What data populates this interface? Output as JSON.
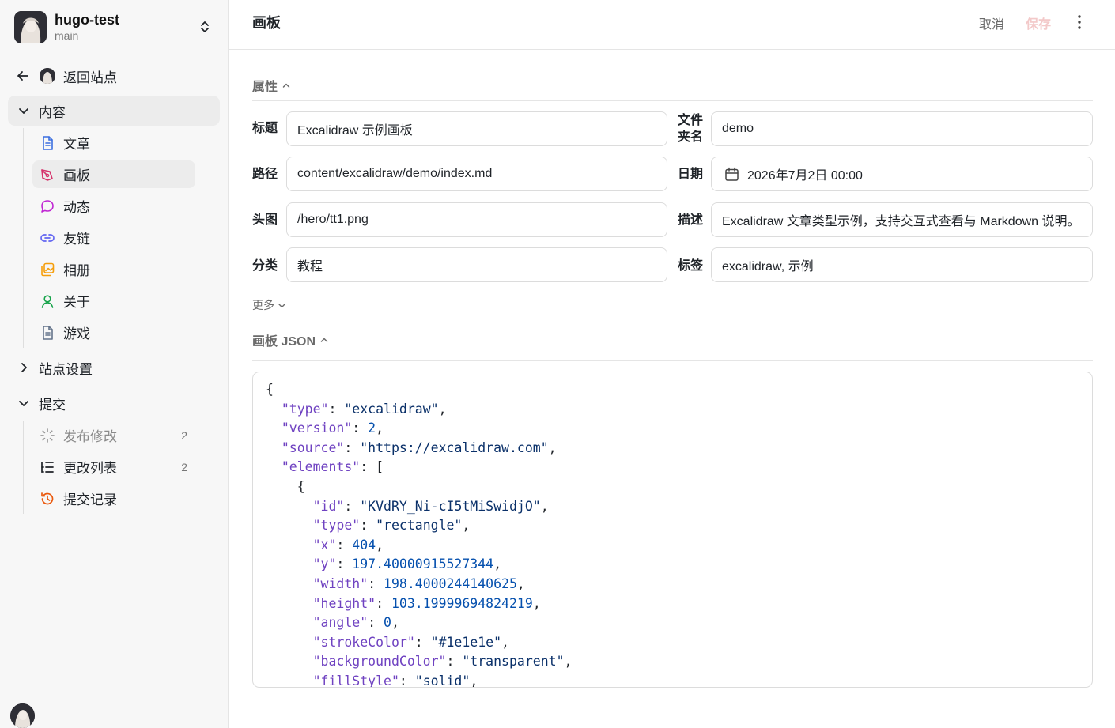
{
  "sidebar": {
    "site_name": "hugo-test",
    "branch": "main",
    "back_label": "返回站点",
    "groups": {
      "content": "内容",
      "site_settings": "站点设置",
      "commit": "提交"
    },
    "content_items": [
      {
        "label": "文章",
        "icon": "document-icon"
      },
      {
        "label": "画板",
        "icon": "pen-tool-icon"
      },
      {
        "label": "动态",
        "icon": "chat-bubble-icon"
      },
      {
        "label": "友链",
        "icon": "link-icon"
      },
      {
        "label": "相册",
        "icon": "image-gallery-icon"
      },
      {
        "label": "关于",
        "icon": "user-icon"
      },
      {
        "label": "游戏",
        "icon": "document-icon"
      }
    ],
    "commit_items": [
      {
        "label": "发布修改",
        "count": "2",
        "icon": "loader-icon"
      },
      {
        "label": "更改列表",
        "count": "2",
        "icon": "list-tree-icon"
      },
      {
        "label": "提交记录",
        "count": "",
        "icon": "history-icon"
      }
    ]
  },
  "header": {
    "title": "画板",
    "cancel_label": "取消",
    "save_label": "保存"
  },
  "properties": {
    "section_title": "属性",
    "title_label": "标题",
    "title_value": "Excalidraw 示例画板",
    "folder_label_line1": "文件",
    "folder_label_line2": "夹名",
    "folder_value": "demo",
    "path_label": "路径",
    "path_value": "content/excalidraw/demo/index.md",
    "date_label": "日期",
    "date_value": "2026年7月2日 00:00",
    "hero_label": "头图",
    "hero_value": "/hero/tt1.png",
    "desc_label": "描述",
    "desc_value": "Excalidraw 文章类型示例，支持交互式查看与 Markdown 说明。",
    "category_label": "分类",
    "category_value": "教程",
    "tags_label": "标签",
    "tags_value": "excalidraw, 示例",
    "more_label": "更多"
  },
  "json_section": {
    "title": "画板 JSON",
    "lines": [
      {
        "indent": 0,
        "parts": [
          {
            "t": "pun",
            "v": "{"
          }
        ]
      },
      {
        "indent": 1,
        "parts": [
          {
            "t": "key",
            "v": "\"type\""
          },
          {
            "t": "pun",
            "v": ": "
          },
          {
            "t": "str",
            "v": "\"excalidraw\""
          },
          {
            "t": "pun",
            "v": ","
          }
        ]
      },
      {
        "indent": 1,
        "parts": [
          {
            "t": "key",
            "v": "\"version\""
          },
          {
            "t": "pun",
            "v": ": "
          },
          {
            "t": "num",
            "v": "2"
          },
          {
            "t": "pun",
            "v": ","
          }
        ]
      },
      {
        "indent": 1,
        "parts": [
          {
            "t": "key",
            "v": "\"source\""
          },
          {
            "t": "pun",
            "v": ": "
          },
          {
            "t": "str",
            "v": "\"https://excalidraw.com\""
          },
          {
            "t": "pun",
            "v": ","
          }
        ]
      },
      {
        "indent": 1,
        "parts": [
          {
            "t": "key",
            "v": "\"elements\""
          },
          {
            "t": "pun",
            "v": ": ["
          }
        ]
      },
      {
        "indent": 2,
        "parts": [
          {
            "t": "pun",
            "v": "{"
          }
        ]
      },
      {
        "indent": 3,
        "parts": [
          {
            "t": "key",
            "v": "\"id\""
          },
          {
            "t": "pun",
            "v": ": "
          },
          {
            "t": "str",
            "v": "\"KVdRY_Ni-cI5tMiSwidjO\""
          },
          {
            "t": "pun",
            "v": ","
          }
        ]
      },
      {
        "indent": 3,
        "parts": [
          {
            "t": "key",
            "v": "\"type\""
          },
          {
            "t": "pun",
            "v": ": "
          },
          {
            "t": "str",
            "v": "\"rectangle\""
          },
          {
            "t": "pun",
            "v": ","
          }
        ]
      },
      {
        "indent": 3,
        "parts": [
          {
            "t": "key",
            "v": "\"x\""
          },
          {
            "t": "pun",
            "v": ": "
          },
          {
            "t": "num",
            "v": "404"
          },
          {
            "t": "pun",
            "v": ","
          }
        ]
      },
      {
        "indent": 3,
        "parts": [
          {
            "t": "key",
            "v": "\"y\""
          },
          {
            "t": "pun",
            "v": ": "
          },
          {
            "t": "num",
            "v": "197.40000915527344"
          },
          {
            "t": "pun",
            "v": ","
          }
        ]
      },
      {
        "indent": 3,
        "parts": [
          {
            "t": "key",
            "v": "\"width\""
          },
          {
            "t": "pun",
            "v": ": "
          },
          {
            "t": "num",
            "v": "198.4000244140625"
          },
          {
            "t": "pun",
            "v": ","
          }
        ]
      },
      {
        "indent": 3,
        "parts": [
          {
            "t": "key",
            "v": "\"height\""
          },
          {
            "t": "pun",
            "v": ": "
          },
          {
            "t": "num",
            "v": "103.19999694824219"
          },
          {
            "t": "pun",
            "v": ","
          }
        ]
      },
      {
        "indent": 3,
        "parts": [
          {
            "t": "key",
            "v": "\"angle\""
          },
          {
            "t": "pun",
            "v": ": "
          },
          {
            "t": "num",
            "v": "0"
          },
          {
            "t": "pun",
            "v": ","
          }
        ]
      },
      {
        "indent": 3,
        "parts": [
          {
            "t": "key",
            "v": "\"strokeColor\""
          },
          {
            "t": "pun",
            "v": ": "
          },
          {
            "t": "str",
            "v": "\"#1e1e1e\""
          },
          {
            "t": "pun",
            "v": ","
          }
        ]
      },
      {
        "indent": 3,
        "parts": [
          {
            "t": "key",
            "v": "\"backgroundColor\""
          },
          {
            "t": "pun",
            "v": ": "
          },
          {
            "t": "str",
            "v": "\"transparent\""
          },
          {
            "t": "pun",
            "v": ","
          }
        ]
      },
      {
        "indent": 3,
        "parts": [
          {
            "t": "key",
            "v": "\"fillStyle\""
          },
          {
            "t": "pun",
            "v": ": "
          },
          {
            "t": "str",
            "v": "\"solid\""
          },
          {
            "t": "pun",
            "v": ","
          }
        ]
      }
    ]
  },
  "colors": {
    "accent": "#d6336c",
    "save_disabled": "#f3c9c9",
    "json_key": "#6f42c1",
    "json_string": "#0a3069",
    "json_number": "#0550ae"
  }
}
